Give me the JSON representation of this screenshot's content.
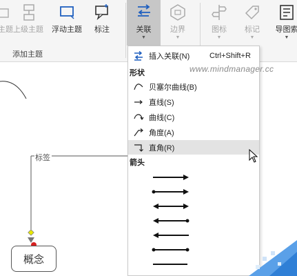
{
  "ribbon": {
    "buttons": [
      {
        "label": "主题",
        "icon": "topic-icon",
        "disabled": true
      },
      {
        "label": "上级主题",
        "icon": "parent-topic-icon",
        "disabled": true
      },
      {
        "label": "浮动主题",
        "icon": "floating-topic-icon",
        "disabled": false
      },
      {
        "label": "标注",
        "icon": "callout-icon",
        "disabled": false
      },
      {
        "label": "关联",
        "icon": "relationship-icon",
        "disabled": false
      },
      {
        "label": "边界",
        "icon": "boundary-icon",
        "disabled": true
      },
      {
        "label": "图标",
        "icon": "icon-library-icon",
        "disabled": true
      },
      {
        "label": "标记",
        "icon": "tag-icon",
        "disabled": true
      },
      {
        "label": "导图索",
        "icon": "map-index-icon",
        "disabled": false
      }
    ],
    "group_label": "添加主题"
  },
  "menu": {
    "insert": {
      "label": "插入关联(N)",
      "shortcut": "Ctrl+Shift+R"
    },
    "shape_header": "形状",
    "shapes": [
      {
        "label": "贝塞尔曲线(B)",
        "icon": "bezier-curve-icon"
      },
      {
        "label": "直线(S)",
        "icon": "straight-line-icon"
      },
      {
        "label": "曲线(C)",
        "icon": "curve-icon"
      },
      {
        "label": "角度(A)",
        "icon": "angle-line-icon"
      },
      {
        "label": "直角(R)",
        "icon": "right-angle-icon",
        "highlighted": true
      }
    ],
    "arrow_header": "箭头"
  },
  "watermark": "www.mindmanager.cc",
  "canvas": {
    "tag_label": "标签",
    "concept_label": "概念"
  },
  "colors": {
    "accent": "#1f5fbf",
    "connector_diamond": "#e8e800",
    "connector_dot": "#d62020",
    "menu_highlight": "#e3e3e3"
  }
}
